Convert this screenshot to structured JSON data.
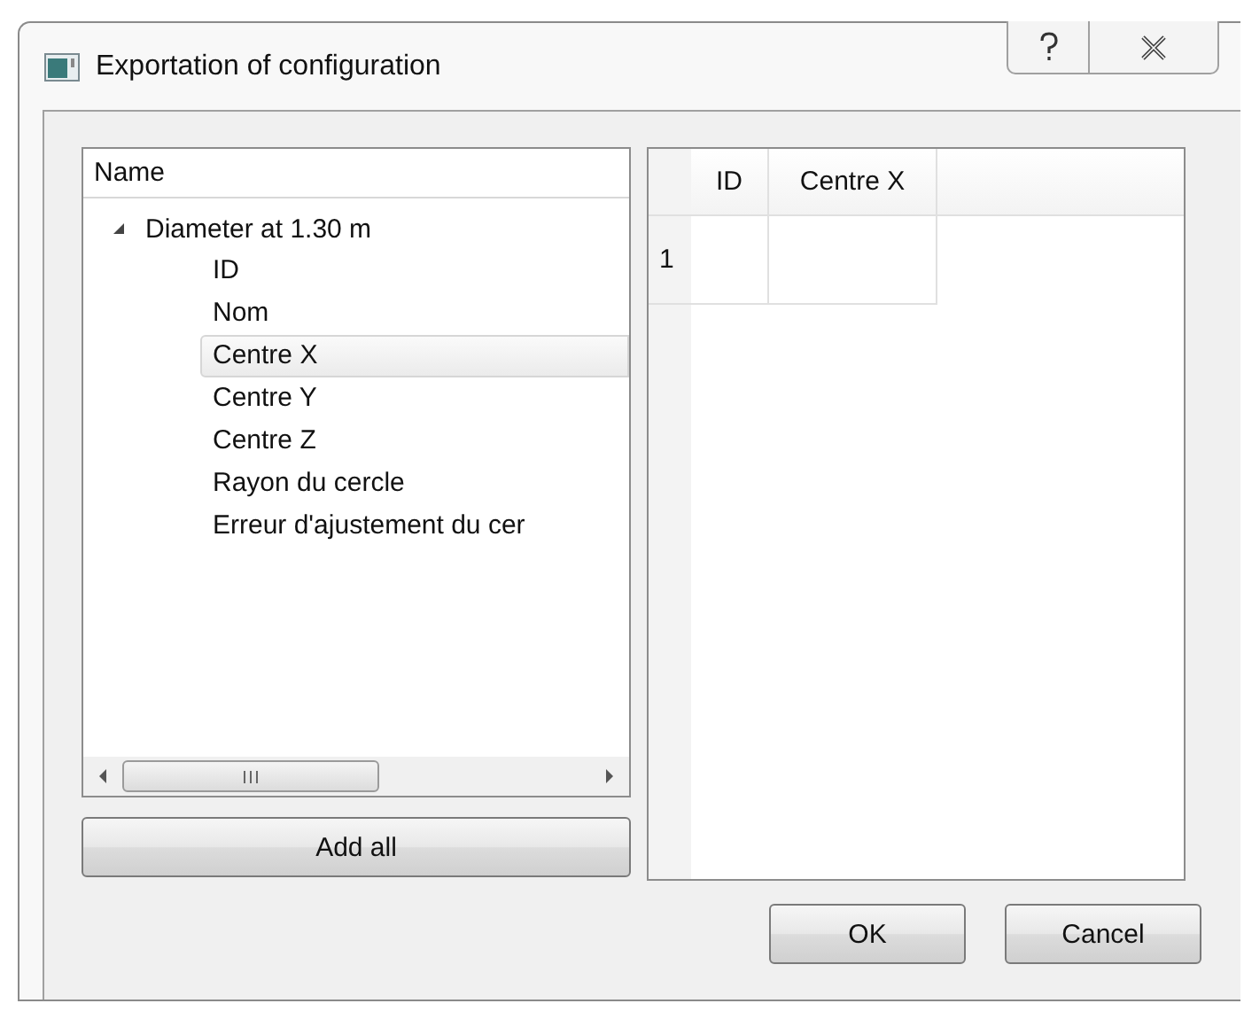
{
  "window": {
    "title": "Exportation of configuration"
  },
  "tree": {
    "header": "Name",
    "items": [
      {
        "label": "Diameter at 1.30 m",
        "expanded": true,
        "selected": false,
        "children": [
          {
            "label": "ID",
            "selected": false
          },
          {
            "label": "Nom",
            "selected": false
          },
          {
            "label": "Centre X",
            "selected": true
          },
          {
            "label": "Centre Y",
            "selected": false
          },
          {
            "label": "Centre Z",
            "selected": false
          },
          {
            "label": "Rayon du cercle",
            "selected": false
          },
          {
            "label": "Erreur d'ajustement du cer",
            "selected": false
          }
        ]
      }
    ]
  },
  "add_all_button": "Add all",
  "table": {
    "columns": [
      "ID",
      "Centre X"
    ],
    "rows": [
      {
        "header": "1"
      }
    ]
  },
  "buttons": [
    "OK",
    "Cancel"
  ]
}
